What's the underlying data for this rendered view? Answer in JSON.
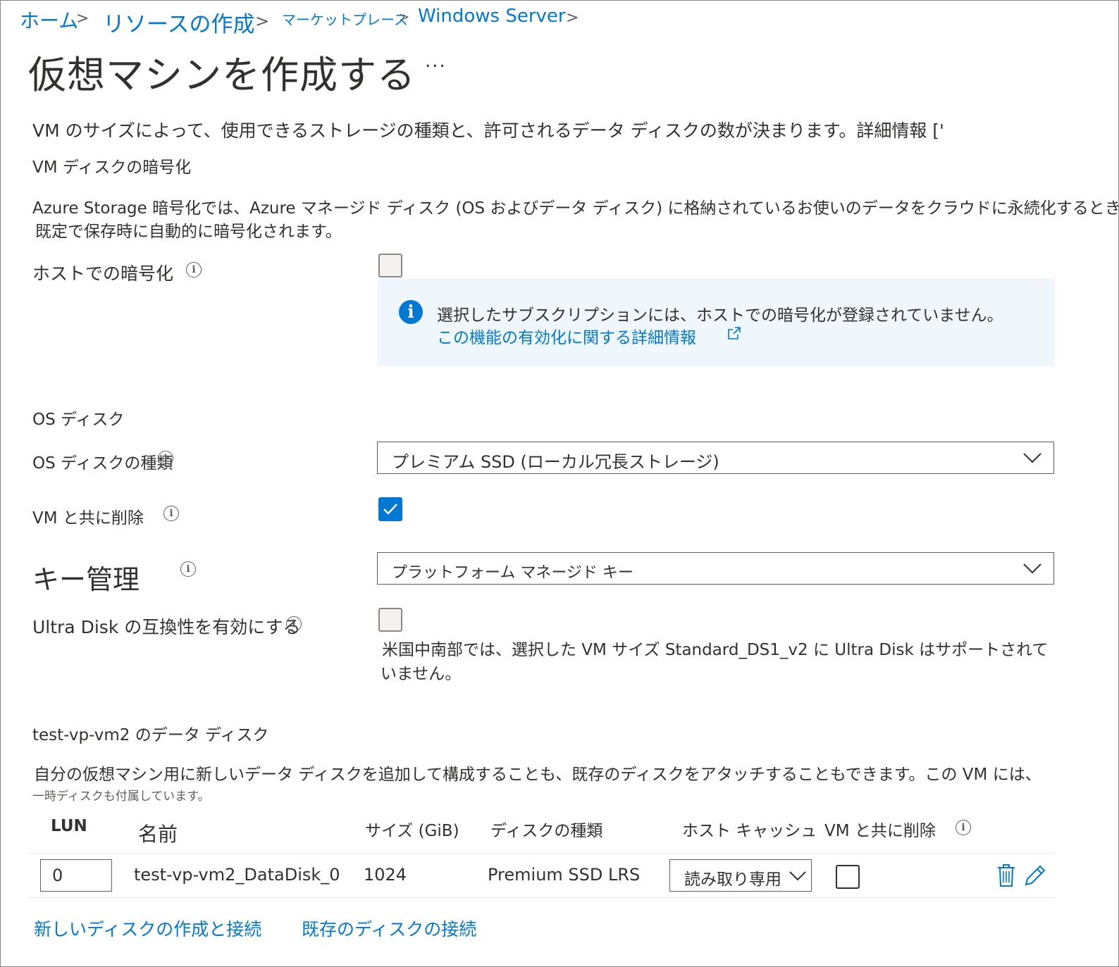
{
  "breadcrumb": {
    "home": "ホーム",
    "create_resource": "リソースの作成",
    "marketplace": "マーケットプレース",
    "windows_server": "Windows Server",
    "separator": ">"
  },
  "page": {
    "title": "仮想マシンを作成する",
    "more": "..."
  },
  "intro_text": "VM のサイズによって、使用できるストレージの種類と、許可されるデータ ディスクの数が決まります。詳細情報 ['",
  "encryption": {
    "heading": "VM ディスクの暗号化",
    "description_line1": "Azure  Storage 暗号化では、Azure マネージド ディスク (OS およびデータ ディスク) に格納されているお使いのデータをクラウドに永続化するときに、",
    "description_line2": "既定で保存時に自動的に暗号化されます。",
    "host_label": "ホストでの暗号化",
    "banner_text": "選択したサブスクリプションには、ホストでの暗号化が登録されていません。",
    "banner_link": "この機能の有効化に関する詳細情報"
  },
  "os_disk": {
    "heading": "OS ディスク",
    "type_label": "OS ディスクの種類",
    "type_value": "プレミアム SSD (ローカル冗長ストレージ)",
    "delete_label": "VM と共に削除",
    "key_label": "キー管理",
    "key_value": "プラットフォーム マネージド キー",
    "ultra_label": "Ultra Disk の互換性を有効にする",
    "ultra_note_line1": "米国中南部では、選択した VM サイズ Standard_DS1_v2 に Ultra Disk はサポートされて",
    "ultra_note_line2": "いません。"
  },
  "data_disks": {
    "heading": "test-vp-vm2 のデータ ディスク",
    "description_line1": "自分の仮想マシン用に新しいデータ ディスクを追加して構成することも、既存のディスクをアタッチすることもできます。この VM には、",
    "description_line2": "一時ディスクも付属しています。",
    "columns": {
      "lun": "LUN",
      "name": "名前",
      "size": "サイズ (GiB)",
      "type": "ディスクの種類",
      "cache": "ホスト キャッシュ",
      "delete": "VM と共に削除"
    },
    "rows": [
      {
        "lun": "0",
        "name": "test-vp-vm2_DataDisk_0",
        "size": "1024",
        "type": "Premium SSD LRS",
        "cache": "読み取り専用"
      }
    ],
    "create_link": "新しいディスクの作成と接続",
    "attach_link": "既存のディスクの接続"
  },
  "colors": {
    "accent": "#0078d4",
    "banner_bg": "#eff6fc",
    "text": "#323130",
    "border": "#605e5c"
  },
  "icons": [
    "info-icon",
    "external-link-icon",
    "chevron-down-icon",
    "checkmark-icon",
    "trash-icon",
    "pencil-icon"
  ]
}
